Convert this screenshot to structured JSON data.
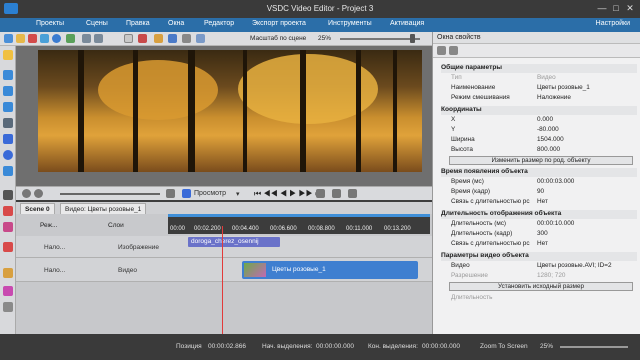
{
  "window": {
    "title": "VSDC Video Editor - Project 3",
    "min": "—",
    "max": "□",
    "close": "✕"
  },
  "menu": {
    "items": [
      "Проекты",
      "Сцены",
      "Правка",
      "Окна",
      "Редактор",
      "Экспорт проекта",
      "Инструменты",
      "Активация"
    ],
    "settings": "Настройки"
  },
  "toolbar": {
    "zoom_label": "Масштаб по сцене",
    "zoom_value": "25%"
  },
  "preview": {
    "label": "Просмотр"
  },
  "tabs": {
    "scene": "Scene 0",
    "clip": "Видео: Цветы розовые_1"
  },
  "timeline": {
    "layers_label": "Слои",
    "ruler_ticks": [
      "00:00",
      "00:02.200",
      "00:04.400",
      "00:06.600",
      "00:08.800",
      "00:11.000",
      "00:13.200"
    ],
    "rows": [
      {
        "blend": "Нало...",
        "type": "Изображение",
        "clip": "doroga_cherez_osennij"
      },
      {
        "blend": "Нало...",
        "type": "Видео",
        "clip": "Цветы розовые_1"
      }
    ],
    "head_blend": "Реж..."
  },
  "status": {
    "position_label": "Позиция",
    "position": "00:00:02.866",
    "sel_start_label": "Нач. выделения:",
    "sel_start": "00:00:00.000",
    "sel_end_label": "Кон. выделения:",
    "sel_end": "00:00:00.000",
    "zoom_to_screen": "Zoom To Screen",
    "zoom": "25%"
  },
  "properties": {
    "title": "Окна свойств",
    "general": {
      "header": "Общие параметры",
      "type_k": "Тип",
      "type_v": "Видео",
      "name_k": "Наименование",
      "name_v": "Цветы розовые_1",
      "blend_k": "Режим смешивания",
      "blend_v": "Наложение"
    },
    "coords": {
      "header": "Координаты",
      "x_k": "X",
      "x_v": "0.000",
      "y_k": "Y",
      "y_v": "-80.000",
      "w_k": "Ширина",
      "w_v": "1504.000",
      "h_k": "Высота",
      "h_v": "800.000",
      "btn": "Изменить размер по род. объекту"
    },
    "appear": {
      "header": "Время появления объекта",
      "ms_k": "Время (мс)",
      "ms_v": "00:00:03.000",
      "fr_k": "Время (кадр)",
      "fr_v": "90",
      "link_k": "Связь с длительностью рс",
      "link_v": "Нет"
    },
    "duration": {
      "header": "Длительность отображения объекта",
      "ms_k": "Длительность (мс)",
      "ms_v": "00:00:10.000",
      "fr_k": "Длительность (кадр)",
      "fr_v": "300",
      "link_k": "Связь с длительностью рс",
      "link_v": "Нет"
    },
    "video": {
      "header": "Параметры видео объекта",
      "vid_k": "Видео",
      "vid_v": "Цветы розовые.AVI; ID=2",
      "res_k": "Разрешение",
      "res_v": "1280; 720",
      "btn": "Установить исходный размер",
      "dur_k": "Длительность"
    }
  }
}
